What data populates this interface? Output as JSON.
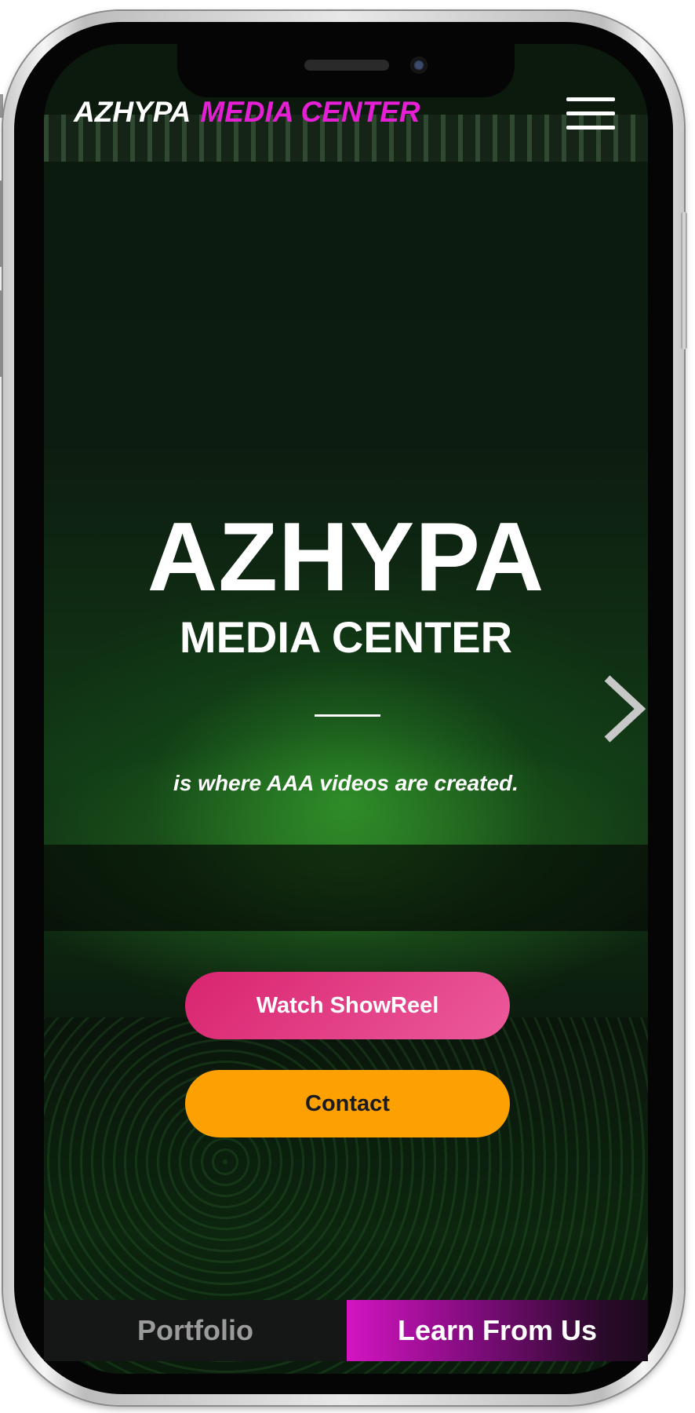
{
  "header": {
    "brand_part1": "AZHYPA",
    "brand_part2": "MEDIA CENTER",
    "brand_accent_color": "#e51fd3",
    "menu_icon": "hamburger-menu-icon"
  },
  "hero": {
    "title": "AZHYPA",
    "subtitle": "MEDIA CENTER",
    "tagline": "is where AAA videos are created.",
    "next_icon": "chevron-right-icon"
  },
  "actions": {
    "showreel_label": "Watch ShowReel",
    "showreel_color": "#d9246f",
    "contact_label": "Contact",
    "contact_color": "#fca101"
  },
  "bottom_tabs": [
    {
      "label": "Portfolio"
    },
    {
      "label": "Learn From Us"
    }
  ]
}
